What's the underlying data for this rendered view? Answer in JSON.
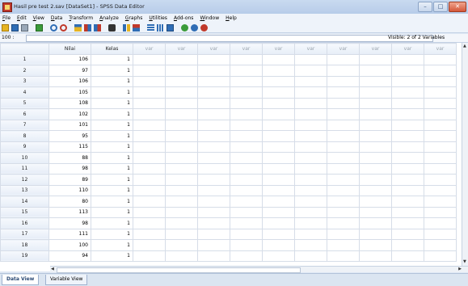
{
  "window": {
    "title": "Hasil pre test 2.sav [DataSet1] - SPSS Data Editor",
    "buttons": {
      "minimize": "–",
      "maximize": "□",
      "close": "✕"
    }
  },
  "menu": [
    "File",
    "Edit",
    "View",
    "Data",
    "Transform",
    "Analyze",
    "Graphs",
    "Utilities",
    "Add-ons",
    "Window",
    "Help"
  ],
  "toolbar": {
    "icons": [
      "open-icon",
      "save-icon",
      "print-icon",
      "dialog-recall-icon",
      "undo-icon",
      "redo-icon",
      "goto-case-icon",
      "insert-case-icon",
      "insert-variable-icon",
      "find-icon",
      "split-file-icon",
      "weight-cases-icon",
      "value-labels-icon",
      "select-cases-icon",
      "use-sets-icon",
      "show-all-icon",
      "spell-icon"
    ],
    "colors": {
      "blue": "#2f6db5",
      "green": "#3a9b3a",
      "red": "#c0392b",
      "yellow": "#e6b422"
    }
  },
  "cell_ref": {
    "label": "100 :",
    "value": "",
    "visible": "Visible: 2 of 2 Variables"
  },
  "grid": {
    "columns": [
      "Nilai",
      "Kelas",
      "var",
      "var",
      "var",
      "var",
      "var",
      "var",
      "var",
      "var",
      "var",
      "var"
    ],
    "rows": [
      {
        "n": "1",
        "nilai": "106",
        "kelas": "1"
      },
      {
        "n": "2",
        "nilai": "97",
        "kelas": "1"
      },
      {
        "n": "3",
        "nilai": "106",
        "kelas": "1"
      },
      {
        "n": "4",
        "nilai": "105",
        "kelas": "1"
      },
      {
        "n": "5",
        "nilai": "108",
        "kelas": "1"
      },
      {
        "n": "6",
        "nilai": "102",
        "kelas": "1"
      },
      {
        "n": "7",
        "nilai": "101",
        "kelas": "1"
      },
      {
        "n": "8",
        "nilai": "95",
        "kelas": "1"
      },
      {
        "n": "9",
        "nilai": "115",
        "kelas": "1"
      },
      {
        "n": "10",
        "nilai": "88",
        "kelas": "1"
      },
      {
        "n": "11",
        "nilai": "98",
        "kelas": "1"
      },
      {
        "n": "12",
        "nilai": "89",
        "kelas": "1"
      },
      {
        "n": "13",
        "nilai": "110",
        "kelas": "1"
      },
      {
        "n": "14",
        "nilai": "80",
        "kelas": "1"
      },
      {
        "n": "15",
        "nilai": "113",
        "kelas": "1"
      },
      {
        "n": "16",
        "nilai": "98",
        "kelas": "1"
      },
      {
        "n": "17",
        "nilai": "111",
        "kelas": "1"
      },
      {
        "n": "18",
        "nilai": "100",
        "kelas": "1"
      },
      {
        "n": "19",
        "nilai": "94",
        "kelas": "1"
      }
    ]
  },
  "tabs": [
    "Data View",
    "Variable View"
  ]
}
